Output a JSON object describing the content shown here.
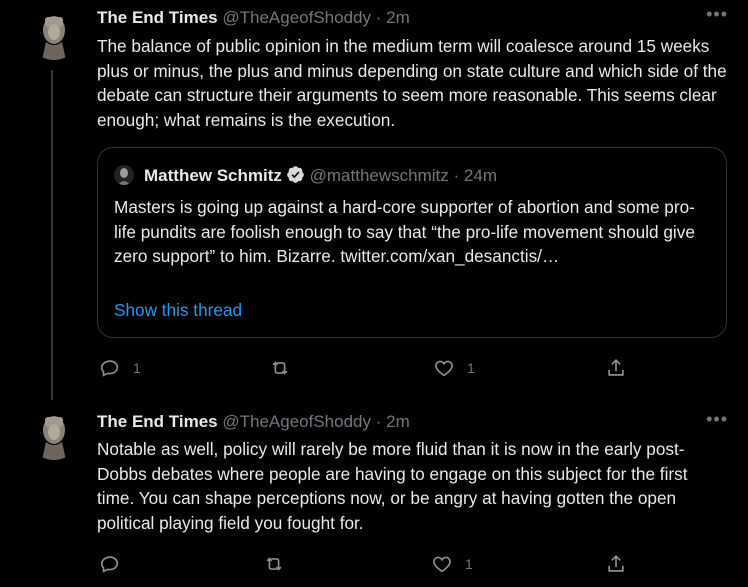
{
  "tweets": [
    {
      "name": "The End Times",
      "handle": "@TheAgeofShoddy",
      "separator": "·",
      "time": "2m",
      "more": "•••",
      "text": "The balance of public opinion in the medium term will coalesce around 15 weeks plus or minus, the plus and minus depending on state culture and which side of the debate can structure their arguments to seem more reasonable. This seems clear enough; what remains is the execution.",
      "quote": {
        "name": "Matthew Schmitz",
        "handle": "@matthewschmitz",
        "separator": "·",
        "time": "24m",
        "text": "Masters is going up against a hard-core supporter of abortion and some pro-life pundits are foolish enough to say that “the pro-life movement should give zero support” to him. Bizarre. twitter.com/xan_desanctis/…",
        "show_thread": "Show this thread"
      },
      "actions": {
        "reply_count": "1",
        "retweet_count": "",
        "like_count": "1"
      }
    },
    {
      "name": "The End Times",
      "handle": "@TheAgeofShoddy",
      "separator": "·",
      "time": "2m",
      "more": "•••",
      "text": "Notable as well, policy will rarely be more fluid than it is now in the early post-Dobbs debates where people are having to engage on this subject for the first time. You can shape perceptions now, or be angry at having gotten the open political playing field you fought for.",
      "actions": {
        "reply_count": "",
        "retweet_count": "",
        "like_count": "1"
      }
    }
  ],
  "colors": {
    "background": "#000000",
    "text": "#e7e9ea",
    "muted": "#71767b",
    "link": "#1d9bf0",
    "border": "#2f3336"
  },
  "icons": [
    "reply-icon",
    "retweet-icon",
    "like-icon",
    "share-icon",
    "more-icon",
    "verified-badge-icon"
  ]
}
